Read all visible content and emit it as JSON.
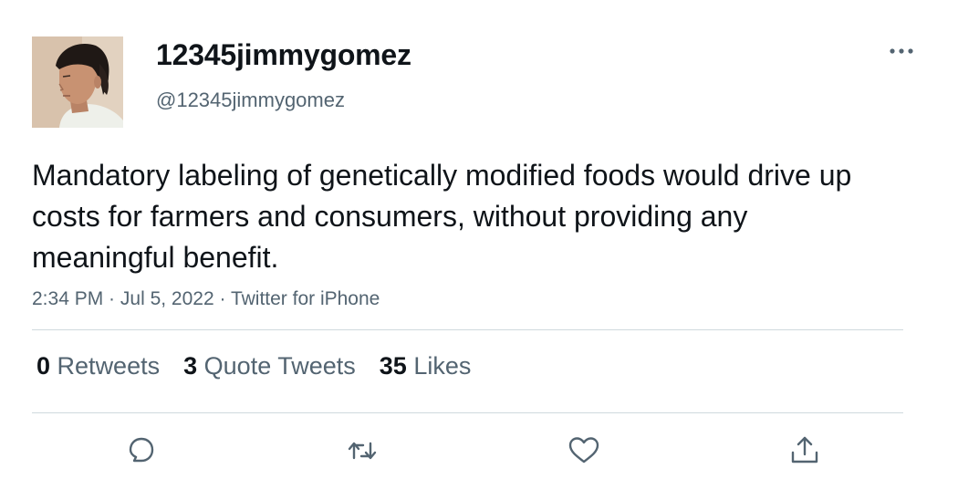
{
  "user": {
    "display_name": "12345jimmygomez",
    "handle": "@12345jimmygomez"
  },
  "tweet": {
    "text": "Mandatory labeling of genetically modified foods would drive up costs for farmers and consumers, without providing any meaningful benefit.",
    "time": "2:34 PM",
    "separator": " · ",
    "date": "Jul 5, 2022",
    "source": "Twitter for iPhone"
  },
  "stats": [
    {
      "count": "0",
      "label": "Retweets"
    },
    {
      "count": "3",
      "label": "Quote Tweets"
    },
    {
      "count": "35",
      "label": "Likes"
    }
  ],
  "actions": [
    "reply-icon",
    "retweet-icon",
    "like-icon",
    "share-icon"
  ],
  "colors": {
    "text": "#0f1419",
    "secondary": "#536471",
    "divider": "#cfd9de",
    "icon": "#536471"
  }
}
